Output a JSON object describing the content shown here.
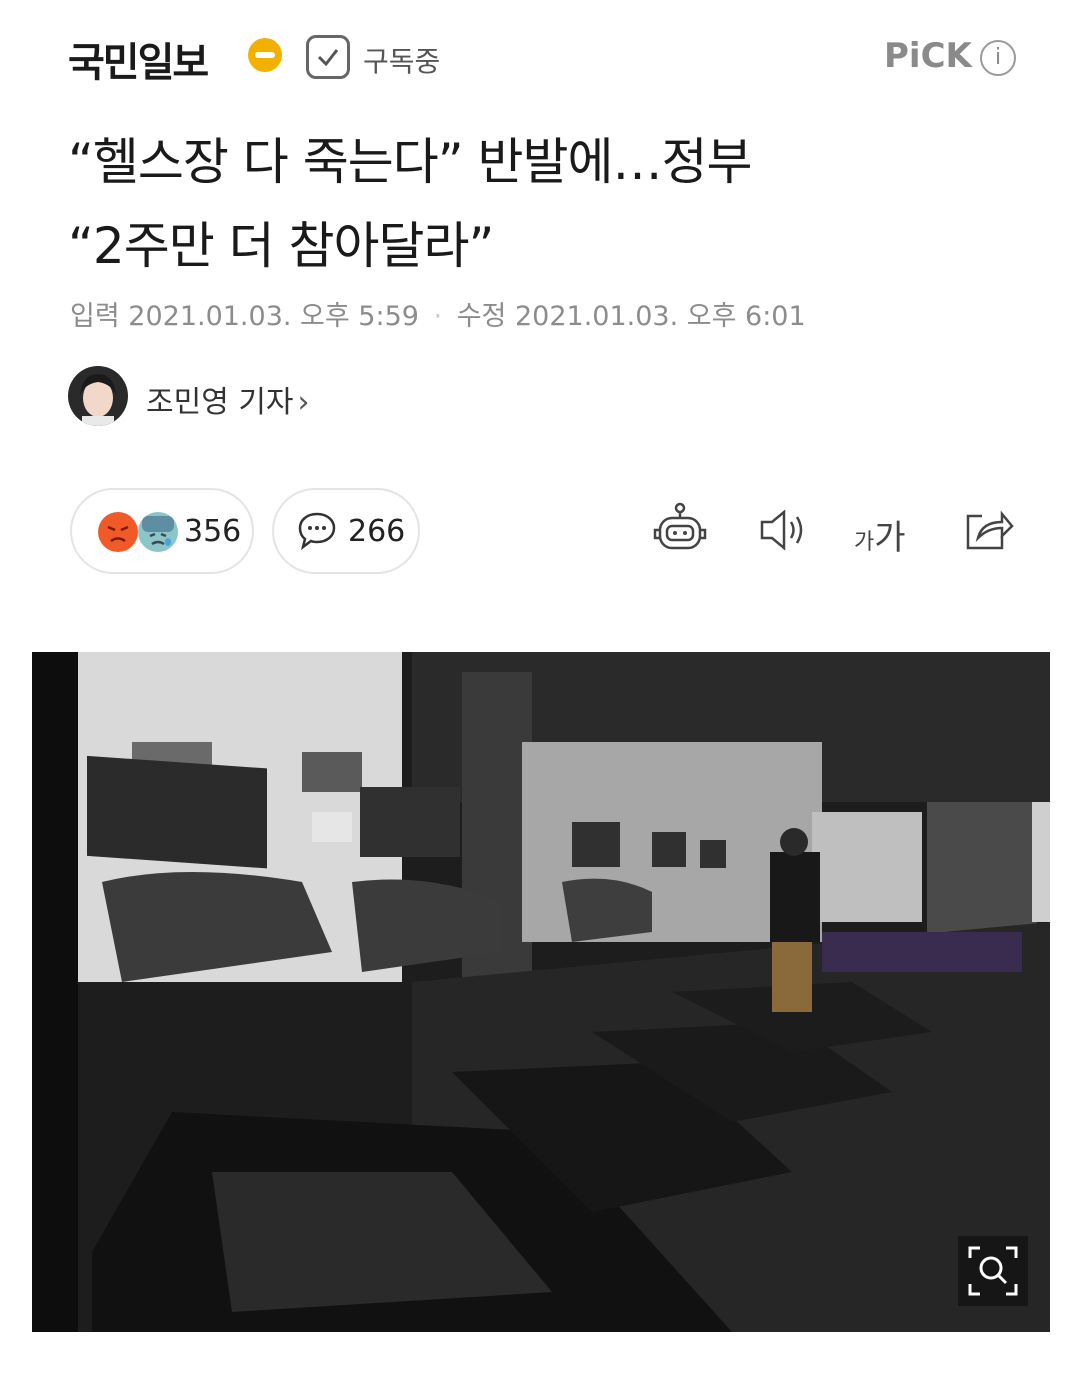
{
  "header": {
    "press_name": "국민일보",
    "subscribe_label": "구독중",
    "pick_label": "PiCK",
    "info_icon": "info-icon"
  },
  "article": {
    "title_line1": "“헬스장 다 죽는다” 반발에…정부",
    "title_line2": "“2주만 더 참아달라”",
    "input_label": "입력",
    "input_time": "2021.01.03. 오후 5:59",
    "edit_label": "수정",
    "edit_time": "2021.01.03. 오후 6:01",
    "reporter": "조민영 기자",
    "reporter_chevron": "›"
  },
  "actions": {
    "reaction_count": "356",
    "comment_count": "266",
    "font_size_label_small": "가",
    "font_size_label_large": "가",
    "icons": [
      "angry-emoji-icon",
      "sad-emoji-icon",
      "comment-icon",
      "robot-summary-icon",
      "speaker-icon",
      "share-icon"
    ]
  },
  "photo": {
    "zoom_icon": "zoom-search-icon"
  },
  "colors": {
    "logo_badge": "#f2b100",
    "meta_text": "#8c8c8c",
    "angry_emoji": "#f05a28",
    "sad_emoji": "#8cc5c8"
  }
}
